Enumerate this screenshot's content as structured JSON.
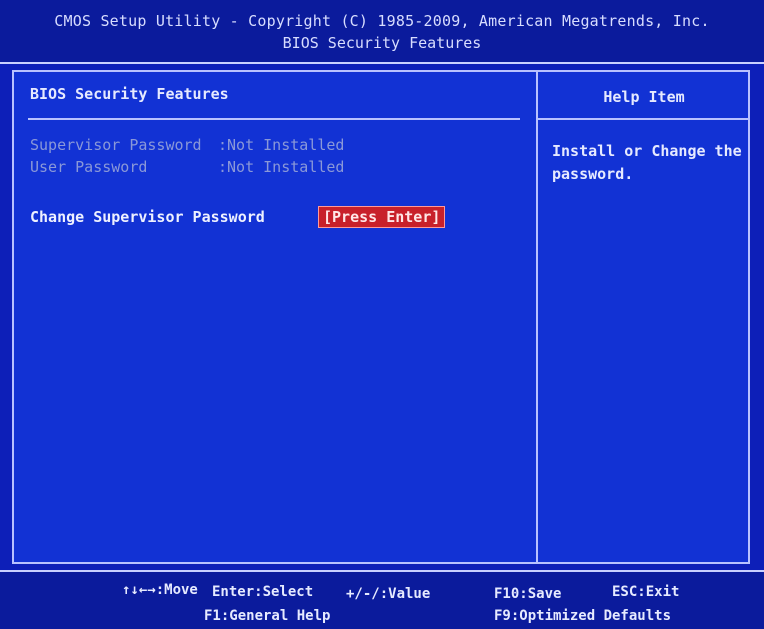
{
  "header": {
    "title": "CMOS Setup Utility - Copyright (C) 1985-2009, American Megatrends, Inc.",
    "subtitle": "BIOS Security Features"
  },
  "main": {
    "section_title": "BIOS Security Features",
    "items": [
      {
        "label": "Supervisor Password",
        "value": ":Not Installed",
        "state": "disabled"
      },
      {
        "label": "User Password",
        "value": ":Not Installed",
        "state": "disabled"
      },
      {
        "label": "Change Supervisor Password",
        "value": "[Press Enter]",
        "state": "selected"
      }
    ]
  },
  "help": {
    "title": "Help Item",
    "text": "Install or Change the password."
  },
  "footer": {
    "move": "↑↓←→:Move",
    "select": "Enter:Select",
    "value": "+/-/:Value",
    "save": "F10:Save",
    "exit": "ESC:Exit",
    "general_help": "F1:General Help",
    "optimized_defaults": "F9:Optimized Defaults"
  },
  "colors": {
    "background": "#1232d4",
    "highlight": "#c8202a",
    "text": "#e6eaff",
    "disabled_text": "#8a98d8"
  }
}
